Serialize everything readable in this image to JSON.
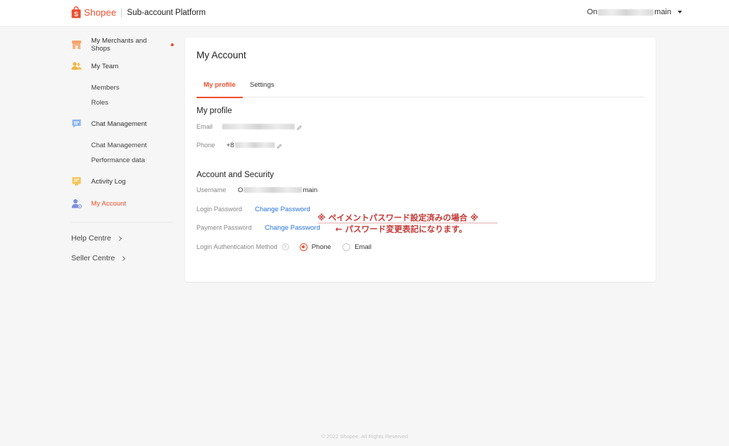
{
  "header": {
    "brand": "Shopee",
    "platform": "Sub-account Platform",
    "user_prefix": "On",
    "user_suffix": "main"
  },
  "sidebar": {
    "items": [
      {
        "label": "My Merchants and Shops",
        "icon": "shop-icon",
        "notify": true
      },
      {
        "label": "My Team",
        "icon": "team-icon"
      },
      {
        "label": "Members"
      },
      {
        "label": "Roles"
      },
      {
        "label": "Chat Management",
        "icon": "chat-icon"
      },
      {
        "label": "Chat Management"
      },
      {
        "label": "Performance data"
      },
      {
        "label": "Activity Log",
        "icon": "log-icon"
      },
      {
        "label": "My Account",
        "icon": "account-icon",
        "active": true
      }
    ],
    "links": [
      {
        "label": "Help Centre"
      },
      {
        "label": "Seller Centre"
      }
    ]
  },
  "main": {
    "title": "My Account",
    "tabs": [
      {
        "label": "My profile",
        "active": true
      },
      {
        "label": "Settings",
        "active": false
      }
    ],
    "profile": {
      "title": "My profile",
      "email_label": "Email",
      "phone_label": "Phone",
      "phone_prefix": "+8"
    },
    "security": {
      "title": "Account and Security",
      "username_label": "Username",
      "username_prefix": "O",
      "username_suffix": "main",
      "login_password_label": "Login Password",
      "login_password_link": "Change Password",
      "payment_password_label": "Payment Password",
      "payment_password_link": "Change Password",
      "auth_label": "Login Authentication Method",
      "auth_options": [
        {
          "label": "Phone",
          "selected": true
        },
        {
          "label": "Email",
          "selected": false
        }
      ]
    }
  },
  "annotation": {
    "line1": "※ ペイメントパスワード設定済みの場合 ※",
    "line2": "← パスワード変更表記になります。"
  },
  "footer": "© 2022 Shopee. All Rights Reserved",
  "colors": {
    "accent": "#ee4d2d",
    "link": "#2673dd",
    "annotation": "#c33a36"
  }
}
